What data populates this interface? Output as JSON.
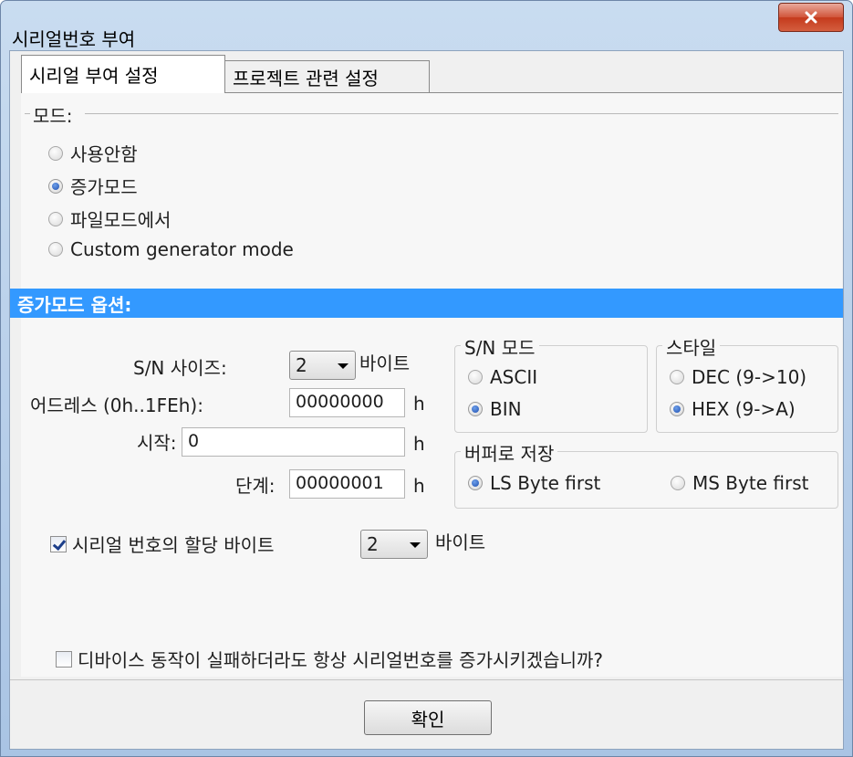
{
  "window": {
    "title": "시리얼번호 부여"
  },
  "tabs": [
    {
      "label": "시리얼 부여 설정"
    },
    {
      "label": "프로젝트 관련 설정"
    }
  ],
  "mode": {
    "label": "모드:",
    "options": [
      {
        "label": "사용안함",
        "selected": false
      },
      {
        "label": "증가모드",
        "selected": true
      },
      {
        "label": "파일모드에서",
        "selected": false
      },
      {
        "label": "Custom generator mode",
        "selected": false
      }
    ]
  },
  "inc_options": {
    "header": "증가모드 옵션:",
    "sn_size_label": "S/N 사이즈:",
    "sn_size_value": "2",
    "sn_size_unit": "바이트",
    "address_label": "어드레스 (0h..1FEh):",
    "address_value": "00000000",
    "address_unit": "h",
    "start_label": "시작:",
    "start_value": "0",
    "start_unit": "h",
    "step_label": "단계:",
    "step_value": "00000001",
    "step_unit": "h"
  },
  "sn_mode": {
    "title": "S/N 모드",
    "options": [
      {
        "label": "ASCII",
        "selected": false
      },
      {
        "label": "BIN",
        "selected": true
      }
    ]
  },
  "style": {
    "title": "스타일",
    "options": [
      {
        "label": "DEC (9->10)",
        "selected": false
      },
      {
        "label": "HEX (9->A)",
        "selected": true
      }
    ]
  },
  "buffer_save": {
    "title": "버퍼로 저장",
    "options": [
      {
        "label": "LS Byte first",
        "selected": true
      },
      {
        "label": "MS Byte first",
        "selected": false
      }
    ]
  },
  "alloc": {
    "label": "시리얼 번호의 할당 바이트",
    "checked": true,
    "value": "2",
    "unit": "바이트"
  },
  "increment_on_fail": {
    "label": "디바이스 동작이 실패하더라도 항상 시리얼번호를 증가시키겠습니까?",
    "checked": false
  },
  "ok_button": "확인",
  "colors": {
    "section_header": "#3399ff",
    "close_button": "#c43a1c"
  }
}
